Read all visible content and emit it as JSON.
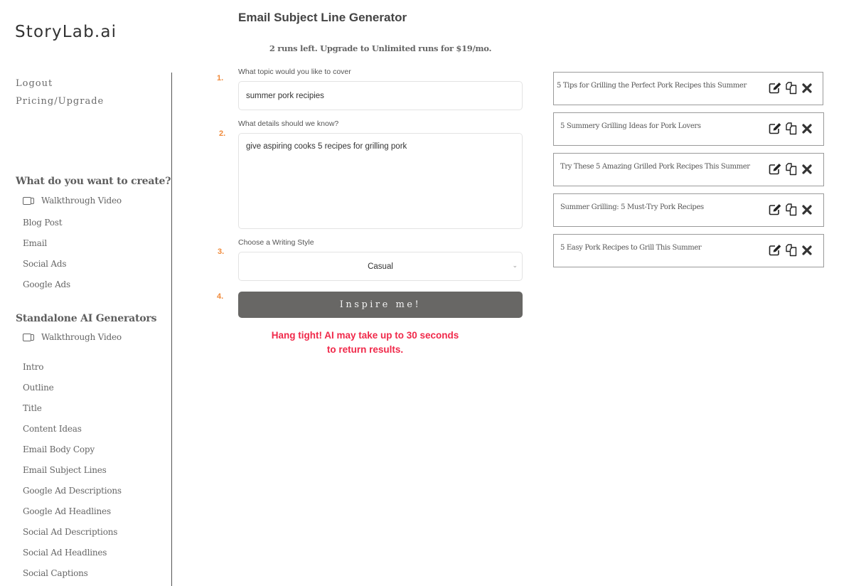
{
  "brand": {
    "logo_text": "StoryLab.ai"
  },
  "top_links": [
    {
      "label": "Logout"
    },
    {
      "label": "Pricing/Upgrade"
    }
  ],
  "sidebar": {
    "create_section": {
      "title": "What do you want to create?",
      "video_label": "Walkthrough Video",
      "items": [
        {
          "label": "Blog Post"
        },
        {
          "label": "Email"
        },
        {
          "label": "Social Ads"
        },
        {
          "label": "Google Ads"
        }
      ]
    },
    "standalone_section": {
      "title": "Standalone AI Generators",
      "video_label": "Walkthrough Video",
      "items": [
        {
          "label": "Intro"
        },
        {
          "label": "Outline"
        },
        {
          "label": "Title"
        },
        {
          "label": "Content Ideas"
        },
        {
          "label": "Email Body Copy"
        },
        {
          "label": "Email Subject Lines"
        },
        {
          "label": "Google Ad Descriptions"
        },
        {
          "label": "Google Ad Headlines"
        },
        {
          "label": "Social Ad Descriptions"
        },
        {
          "label": "Social Ad Headlines"
        },
        {
          "label": "Social Captions"
        }
      ]
    }
  },
  "main": {
    "title": "Email Subject Line Generator",
    "runs_notice": "2 runs left. Upgrade to Unlimited runs for $19/mo.",
    "steps": [
      {
        "number": "1.",
        "label": "What topic would you like to cover",
        "value": "summer pork recipies"
      },
      {
        "number": "2.",
        "label": "What details should we know?",
        "value": "give aspiring cooks 5 recipes for grilling pork"
      },
      {
        "number": "3.",
        "label": "Choose a Writing Style",
        "value": "Casual"
      },
      {
        "number": "4."
      }
    ],
    "submit_label": "Inspire me!",
    "wait_notice_line1": "Hang tight! AI may take up to 30 seconds",
    "wait_notice_line2": "to return results.",
    "accent_color": "#f08a3a",
    "warning_color": "#f0294a"
  },
  "results": [
    {
      "text": "5 Tips for Grilling the Perfect Pork Recipes this Summer"
    },
    {
      "text": "5 Summery Grilling Ideas for Pork Lovers"
    },
    {
      "text": "Try These 5 Amazing Grilled Pork Recipes This Summer"
    },
    {
      "text": "Summer Grilling: 5 Must-Try Pork Recipes"
    },
    {
      "text": "5 Easy Pork Recipes to Grill This Summer"
    }
  ],
  "result_action_icons": [
    "edit-icon",
    "copy-icon",
    "delete-icon"
  ]
}
